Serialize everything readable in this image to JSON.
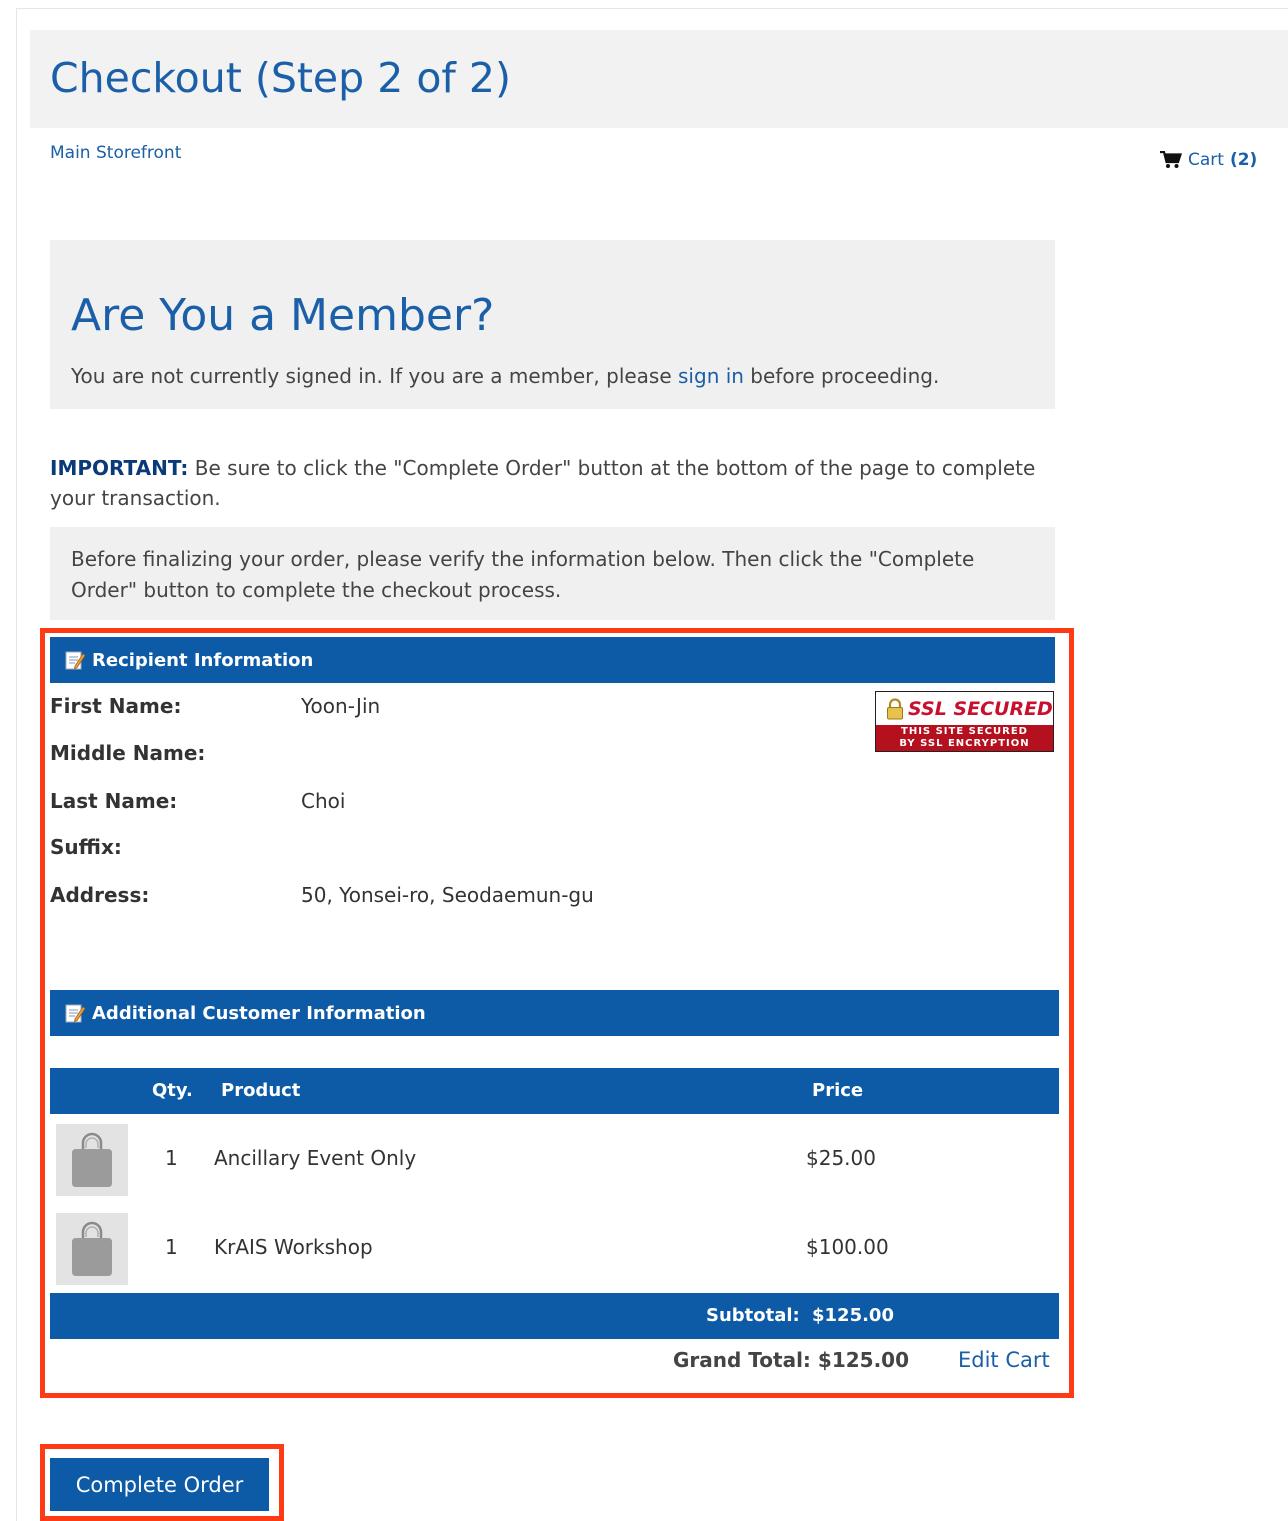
{
  "header": {
    "title": "Checkout (Step 2 of 2)",
    "breadcrumb": "Main Storefront",
    "cart_label": "Cart",
    "cart_count": "(2)"
  },
  "member": {
    "heading": "Are You a Member?",
    "text_before": "You are not currently signed in. If you are a member, please ",
    "link": "sign in",
    "text_after": " before proceeding."
  },
  "notice": {
    "important_label": "IMPORTANT:",
    "important_text": " Be sure to click the \"Complete Order\" button at the bottom of the page to complete your transaction.",
    "verify_text": "Before finalizing your order, please verify the information below. Then click the \"Complete Order\" button to complete the checkout process."
  },
  "recipient": {
    "section_title": "Recipient Information",
    "fields": [
      {
        "label": "First Name:",
        "value": "Yoon-Jin"
      },
      {
        "label": "Middle Name:",
        "value": ""
      },
      {
        "label": "Last Name:",
        "value": "Choi"
      },
      {
        "label": "Suffix:",
        "value": ""
      },
      {
        "label": "Address:",
        "value": "50, Yonsei-ro, Seodaemun-gu"
      }
    ]
  },
  "ssl_badge": {
    "title": "SSL SECURED",
    "line1": "THIS SITE SECURED",
    "line2": "BY SSL ENCRYPTION"
  },
  "additional": {
    "section_title": "Additional Customer Information"
  },
  "cart_table": {
    "columns": {
      "qty": "Qty.",
      "product": "Product",
      "price": "Price"
    },
    "rows": [
      {
        "qty": "1",
        "product": "Ancillary Event Only",
        "price": "$25.00",
        "icon": "shopping-bag-icon"
      },
      {
        "qty": "1",
        "product": "KrAIS Workshop",
        "price": "$100.00",
        "icon": "shopping-bag-icon"
      }
    ],
    "subtotal_label": "Subtotal:",
    "subtotal_value": "$125.00",
    "grand_total_label": "Grand Total:",
    "grand_total_value": "$125.00",
    "edit_cart": "Edit Cart"
  },
  "actions": {
    "complete_order": "Complete Order"
  },
  "colors": {
    "brand_blue": "#0d5aa7",
    "link_blue": "#1a5fa8",
    "highlight": "#ff3b16",
    "ssl_red": "#b5101e"
  }
}
